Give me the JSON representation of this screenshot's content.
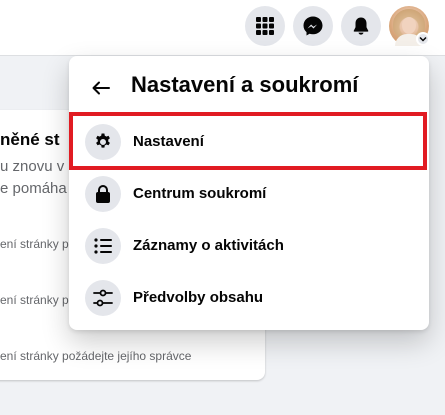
{
  "topbar": {
    "icons": [
      "menu-grid-icon",
      "messenger-icon",
      "notifications-bell-icon"
    ],
    "avatar_alt": "profile"
  },
  "background": {
    "title": "něné st",
    "line1": "u znovu v",
    "line2": "e pomáha",
    "row1": "ení stránky p",
    "row2": "ení stránky p",
    "row3": "ení stránky požádejte jejího správce"
  },
  "dropdown": {
    "title": "Nastavení a soukromí",
    "items": [
      {
        "label": "Nastavení",
        "icon": "gear-icon"
      },
      {
        "label": "Centrum soukromí",
        "icon": "lock-icon"
      },
      {
        "label": "Záznamy o aktivitách",
        "icon": "list-icon"
      },
      {
        "label": "Předvolby obsahu",
        "icon": "sliders-icon"
      }
    ]
  },
  "colors": {
    "highlight": "#e11b22",
    "icon_bg": "#e4e6eb",
    "page_bg": "#f0f2f5"
  }
}
